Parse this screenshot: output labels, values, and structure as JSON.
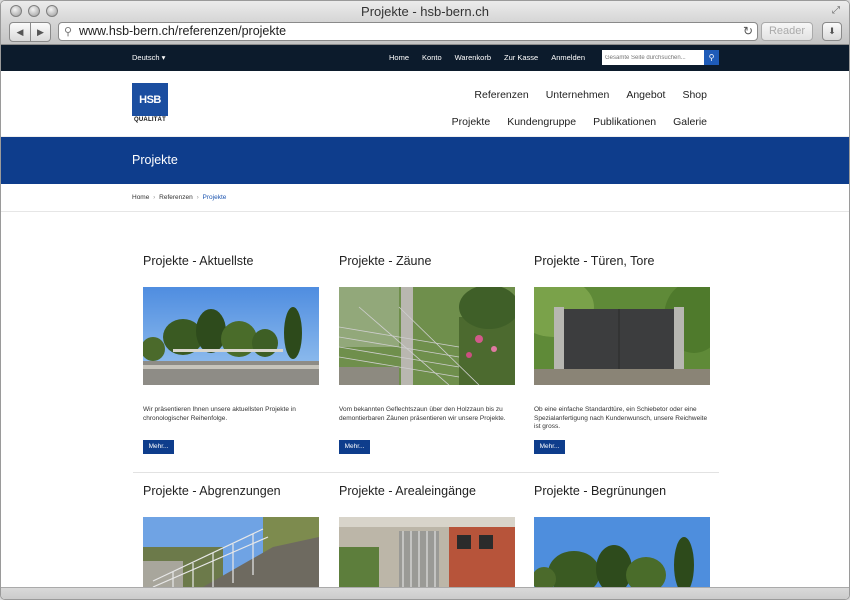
{
  "browser": {
    "window_title": "Projekte  - hsb-bern.ch",
    "url": "www.hsb-bern.ch/referenzen/projekte",
    "reader_label": "Reader"
  },
  "topbar": {
    "language": "Deutsch ▾",
    "links": [
      "Home",
      "Konto",
      "Warenkorb",
      "Zur Kasse",
      "Anmelden"
    ],
    "search_placeholder": "Gesamte Seite durchsuchen..."
  },
  "logo": {
    "text": "HSB",
    "subtitle": "QUALITÄT"
  },
  "nav": {
    "row1": [
      "Referenzen",
      "Unternehmen",
      "Angebot",
      "Shop"
    ],
    "row2": [
      "Projekte",
      "Kundengruppe",
      "Publikationen",
      "Galerie"
    ]
  },
  "banner": {
    "title": "Projekte"
  },
  "breadcrumb": {
    "home": "Home",
    "parent": "Referenzen",
    "current": "Projekte",
    "separator": "›"
  },
  "cards": [
    {
      "title": "Projekte - Aktuellste",
      "desc": "Wir präsentieren Ihnen unsere aktuellsten Projekte in chronologischer Reihenfolge.",
      "button": "Mehr..."
    },
    {
      "title": "Projekte - Zäune",
      "desc": "Vom bekannten Geflechtszaun über den Holzzaun bis zu demontierbaren Zäunen präsentieren wir unsere Projekte.",
      "button": "Mehr..."
    },
    {
      "title": "Projekte - Türen, Tore",
      "desc": "Ob eine einfache Standardtüre, ein Schiebetor oder eine Spezialanfertigung nach Kundenwunsch, unsere Reichweite ist gross.",
      "button": "Mehr..."
    },
    {
      "title": "Projekte - Abgrenzungen"
    },
    {
      "title": "Projekte - Arealeingänge"
    },
    {
      "title": "Projekte - Begrünungen"
    }
  ],
  "colors": {
    "topbar": "#0c1b2c",
    "brand_blue": "#0e3d8c",
    "logo_blue": "#1b4ea0",
    "link_blue": "#1e56b0"
  }
}
